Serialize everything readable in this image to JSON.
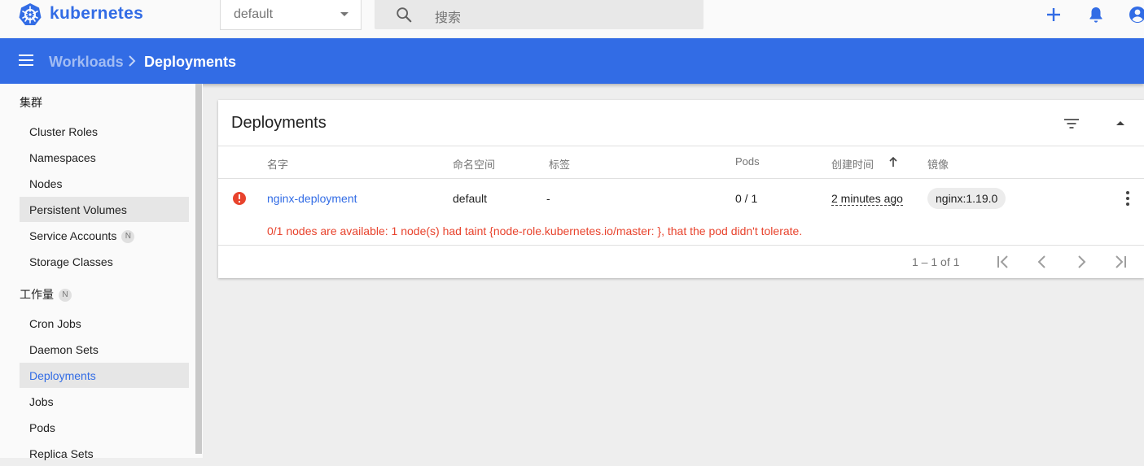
{
  "header": {
    "brand": "kubernetes",
    "namespace": "default",
    "search_placeholder": "搜索"
  },
  "toolbar": {
    "breadcrumb_parent": "Workloads",
    "breadcrumb_current": "Deployments"
  },
  "sidebar": {
    "cluster_section": "集群",
    "cluster_items": [
      "Cluster Roles",
      "Namespaces",
      "Nodes",
      "Persistent Volumes",
      "Service Accounts",
      "Storage Classes"
    ],
    "workload_section": "工作量",
    "workload_items": [
      "Cron Jobs",
      "Daemon Sets",
      "Deployments",
      "Jobs",
      "Pods",
      "Replica Sets"
    ],
    "badge": "N"
  },
  "card": {
    "title": "Deployments",
    "columns": {
      "name": "名字",
      "namespace": "命名空间",
      "labels": "标签",
      "pods": "Pods",
      "created": "创建时间",
      "images": "镜像"
    },
    "row": {
      "name": "nginx-deployment",
      "namespace": "default",
      "labels": "-",
      "pods": "0 / 1",
      "created": "2 minutes ago",
      "image": "nginx:1.19.0",
      "status": "error",
      "message": "0/1 nodes are available: 1 node(s) had taint {node-role.kubernetes.io/master: }, that the pod didn't tolerate."
    },
    "pagination": "1 – 1 of 1"
  },
  "colors": {
    "accent": "#326ce5",
    "error": "#e8432d"
  }
}
